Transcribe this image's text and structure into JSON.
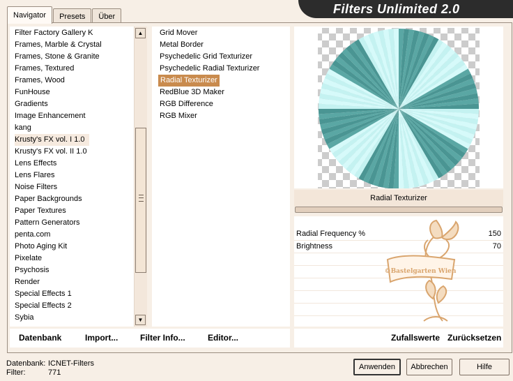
{
  "tabs": [
    "Navigator",
    "Presets",
    "Über"
  ],
  "app_title": "Filters Unlimited 2.0",
  "categories": [
    "Filter Factory Gallery K",
    "Frames, Marble & Crystal",
    "Frames, Stone & Granite",
    "Frames, Textured",
    "Frames, Wood",
    "FunHouse",
    "Gradients",
    "Image Enhancement",
    "kang",
    "Krusty's FX vol. I 1.0",
    "Krusty's FX vol. II 1.0",
    "Lens Effects",
    "Lens Flares",
    "Noise Filters",
    "Paper Backgrounds",
    "Paper Textures",
    "Pattern Generators",
    "penta.com",
    "Photo Aging Kit",
    "Pixelate",
    "Psychosis",
    "Render",
    "Special Effects 1",
    "Special Effects 2",
    "Sybia"
  ],
  "highlighted_category": "Krusty's FX vol. I 1.0",
  "filters": [
    "Grid Mover",
    "Metal Border",
    "Psychedelic Grid Texturizer",
    "Psychedelic Radial Texturizer",
    "Radial Texturizer",
    "RedBlue 3D Maker",
    "RGB Difference",
    "RGB Mixer"
  ],
  "selected_filter": "Radial Texturizer",
  "preview_filter_name": "Radial Texturizer",
  "params": [
    {
      "label": "Radial Frequency %",
      "value": "150"
    },
    {
      "label": "Brightness",
      "value": "70"
    }
  ],
  "bottom_left": {
    "datenbank": "Datenbank",
    "import": "Import...",
    "filter_info": "Filter Info...",
    "editor": "Editor..."
  },
  "bottom_right": {
    "zufallswerte": "Zufallswerte",
    "zuruecksetzen": "Zurücksetzen"
  },
  "info": {
    "datenbank_label": "Datenbank:",
    "datenbank_value": "ICNET-Filters",
    "filter_label": "Filter:",
    "filter_value": "771"
  },
  "buttons": {
    "anwenden": "Anwenden",
    "abbrechen": "Abbrechen",
    "hilfe": "Hilfe"
  },
  "watermark_text": "©Bastelgarten Wien",
  "colors": {
    "dark_teal": "#4a9593",
    "light_teal": "#d6fafa",
    "selection": "#c98b4e",
    "watermark": "#d9a56e"
  }
}
